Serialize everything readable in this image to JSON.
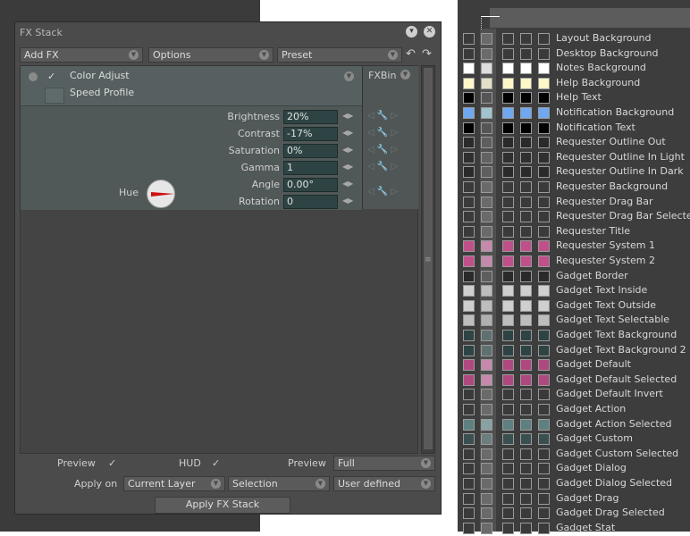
{
  "fx": {
    "title": "FX Stack",
    "menu": {
      "add_fx": "Add FX",
      "options": "Options",
      "preset": "Preset"
    },
    "fxbin": "FXBin",
    "effect": {
      "name": "Color Adjust",
      "speed_profile": "Speed Profile"
    },
    "params": [
      {
        "label": "Brightness",
        "value": "20%"
      },
      {
        "label": "Contrast",
        "value": "-17%"
      },
      {
        "label": "Saturation",
        "value": "0%"
      },
      {
        "label": "Gamma",
        "value": "1"
      },
      {
        "label": "Angle",
        "value": "0.00°"
      },
      {
        "label": "Rotation",
        "value": "0"
      }
    ],
    "hue_label": "Hue",
    "footer": {
      "preview1": "Preview",
      "hud": "HUD",
      "preview2": "Preview",
      "preview_mode": "Full",
      "apply_on": "Apply on",
      "layer": "Current Layer",
      "selection": "Selection",
      "user_defined": "User defined",
      "apply_btn": "Apply FX Stack"
    }
  },
  "colors": {
    "items": [
      {
        "name": "Layout Background",
        "c": [
          "#3a3a3a",
          "#6a6a6a",
          "#3a3a3a",
          "#3a3a3a",
          "#3a3a3a"
        ]
      },
      {
        "name": "Desktop Background",
        "c": [
          "#3a3a3a",
          "#6a6a6a",
          "#3a3a3a",
          "#3a3a3a",
          "#3a3a3a"
        ]
      },
      {
        "name": "Notes Background",
        "c": [
          "#ffffff",
          "#dedede",
          "#ffffff",
          "#ffffff",
          "#ffffff"
        ]
      },
      {
        "name": "Help Background",
        "c": [
          "#fff7c8",
          "#e2dfc6",
          "#fff7c8",
          "#fff7c8",
          "#fff7c8"
        ]
      },
      {
        "name": "Help Text",
        "c": [
          "#000000",
          "#555555",
          "#000000",
          "#000000",
          "#000000"
        ]
      },
      {
        "name": "Notification Background",
        "c": [
          "#6fa8f0",
          "#a0c4cf",
          "#6fa8f0",
          "#6fa8f0",
          "#6fa8f0"
        ]
      },
      {
        "name": "Notification Text",
        "c": [
          "#000000",
          "#555555",
          "#000000",
          "#000000",
          "#000000"
        ]
      },
      {
        "name": "Requester Outline Out",
        "c": [
          "#2a2a2a",
          "#5e5e5e",
          "#2a2a2a",
          "#2a2a2a",
          "#2a2a2a"
        ]
      },
      {
        "name": "Requester Outline In Light",
        "c": [
          "#2f2f2f",
          "#626262",
          "#2f2f2f",
          "#2f2f2f",
          "#2f2f2f"
        ]
      },
      {
        "name": "Requester Outline In Dark",
        "c": [
          "#2a2a2a",
          "#5e5e5e",
          "#2a2a2a",
          "#2a2a2a",
          "#2a2a2a"
        ]
      },
      {
        "name": "Requester Background",
        "c": [
          "#3a3a3a",
          "#6a6a6a",
          "#3a3a3a",
          "#3a3a3a",
          "#3a3a3a"
        ]
      },
      {
        "name": "Requester Drag Bar",
        "c": [
          "#3a3a3a",
          "#6a6a6a",
          "#3a3a3a",
          "#3a3a3a",
          "#3a3a3a"
        ]
      },
      {
        "name": "Requester Drag Bar Selected",
        "c": [
          "#3a3a3a",
          "#6a6a6a",
          "#3a3a3a",
          "#3a3a3a",
          "#3a3a3a"
        ]
      },
      {
        "name": "Requester Title",
        "c": [
          "#3a3a3a",
          "#6a6a6a",
          "#3a3a3a",
          "#3a3a3a",
          "#3a3a3a"
        ]
      },
      {
        "name": "Requester System 1",
        "c": [
          "#c0508a",
          "#c58aab",
          "#c0508a",
          "#c0508a",
          "#c0508a"
        ]
      },
      {
        "name": "Requester System 2",
        "c": [
          "#c0508a",
          "#c58aab",
          "#c0508a",
          "#c0508a",
          "#c0508a"
        ]
      },
      {
        "name": "Gadget Border",
        "c": [
          "#2a2a2a",
          "#5e5e5e",
          "#2a2a2a",
          "#2a2a2a",
          "#2a2a2a"
        ]
      },
      {
        "name": "Gadget Text Inside",
        "c": [
          "#cfcfcf",
          "#bdbdbd",
          "#cfcfcf",
          "#cfcfcf",
          "#cfcfcf"
        ]
      },
      {
        "name": "Gadget Text Outside",
        "c": [
          "#cfcfcf",
          "#bdbdbd",
          "#cfcfcf",
          "#cfcfcf",
          "#cfcfcf"
        ]
      },
      {
        "name": "Gadget Text Selectable",
        "c": [
          "#bdbdbd",
          "#b0b0b0",
          "#bdbdbd",
          "#bdbdbd",
          "#bdbdbd"
        ]
      },
      {
        "name": "Gadget Text Background",
        "c": [
          "#2e4444",
          "#5f7070",
          "#2e4444",
          "#2e4444",
          "#2e4444"
        ]
      },
      {
        "name": "Gadget Text Background 2",
        "c": [
          "#2e4444",
          "#5f7070",
          "#2e4444",
          "#2e4444",
          "#2e4444"
        ]
      },
      {
        "name": "Gadget Default",
        "c": [
          "#b04880",
          "#c58aab",
          "#b04880",
          "#b04880",
          "#b04880"
        ]
      },
      {
        "name": "Gadget Default Selected",
        "c": [
          "#b04880",
          "#c58aab",
          "#b04880",
          "#b04880",
          "#b04880"
        ]
      },
      {
        "name": "Gadget Default Invert",
        "c": [
          "#3a3a3a",
          "#6a6a6a",
          "#3a3a3a",
          "#3a3a3a",
          "#3a3a3a"
        ]
      },
      {
        "name": "Gadget Action",
        "c": [
          "#3a3a3a",
          "#6a6a6a",
          "#3a3a3a",
          "#3a3a3a",
          "#3a3a3a"
        ]
      },
      {
        "name": "Gadget Action Selected",
        "c": [
          "#5e8080",
          "#86a2a2",
          "#5e8080",
          "#5e8080",
          "#5e8080"
        ]
      },
      {
        "name": "Gadget Custom",
        "c": [
          "#3a5050",
          "#6b7d7d",
          "#3a5050",
          "#3a5050",
          "#3a5050"
        ]
      },
      {
        "name": "Gadget Custom Selected",
        "c": [
          "#3a3a3a",
          "#6a6a6a",
          "#3a3a3a",
          "#3a3a3a",
          "#3a3a3a"
        ]
      },
      {
        "name": "Gadget Dialog",
        "c": [
          "#3a3a3a",
          "#6a6a6a",
          "#3a3a3a",
          "#3a3a3a",
          "#3a3a3a"
        ]
      },
      {
        "name": "Gadget Dialog Selected",
        "c": [
          "#3a3a3a",
          "#6a6a6a",
          "#3a3a3a",
          "#3a3a3a",
          "#3a3a3a"
        ]
      },
      {
        "name": "Gadget Drag",
        "c": [
          "#3a3a3a",
          "#6a6a6a",
          "#3a3a3a",
          "#3a3a3a",
          "#3a3a3a"
        ]
      },
      {
        "name": "Gadget Drag Selected",
        "c": [
          "#3a3a3a",
          "#6a6a6a",
          "#3a3a3a",
          "#3a3a3a",
          "#3a3a3a"
        ]
      },
      {
        "name": "Gadget Stat",
        "c": [
          "#3a3a3a",
          "#6a6a6a",
          "#3a3a3a",
          "#3a3a3a",
          "#3a3a3a"
        ]
      }
    ]
  }
}
